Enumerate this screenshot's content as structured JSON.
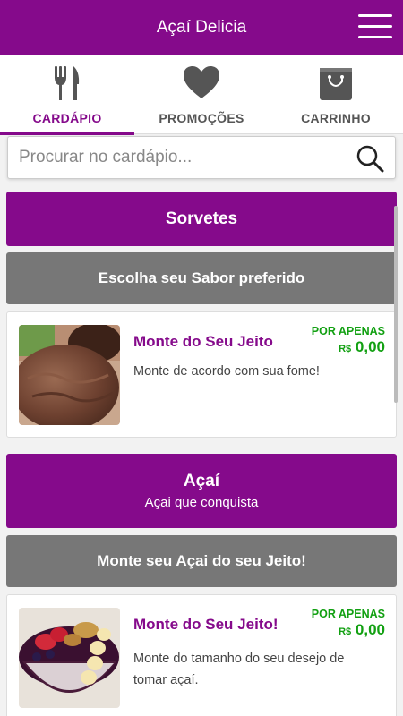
{
  "header": {
    "title": "Açaí Delicia"
  },
  "tabs": [
    {
      "label": "CARDÁPIO",
      "icon": "fork-knife-icon",
      "active": true
    },
    {
      "label": "PROMOÇÕES",
      "icon": "heart-icon",
      "active": false
    },
    {
      "label": "CARRINHO",
      "icon": "shopping-bag-icon",
      "active": false
    }
  ],
  "search": {
    "placeholder": "Procurar no cardápio..."
  },
  "sections": [
    {
      "title": "Sorvetes",
      "subtitle": "",
      "group": "Escolha seu Sabor preferido",
      "item": {
        "name": "Monte do Seu Jeito",
        "description": "Monte de acordo com sua fome!",
        "price_label": "POR APENAS",
        "currency": "R$",
        "price": "0,00",
        "image": "chocolate-ice-cream"
      }
    },
    {
      "title": "Açaí",
      "subtitle": "Açai que conquista",
      "group": "Monte seu Açai do seu Jeito!",
      "item": {
        "name": "Monte do Seu Jeito!",
        "description": "Monte do tamanho do seu desejo de tomar açaí.",
        "price_label": "POR APENAS",
        "currency": "R$",
        "price": "0,00",
        "image": "acai-bowl"
      }
    }
  ],
  "colors": {
    "brand": "#850a8b",
    "secondary": "#777777",
    "price": "#12a012"
  }
}
